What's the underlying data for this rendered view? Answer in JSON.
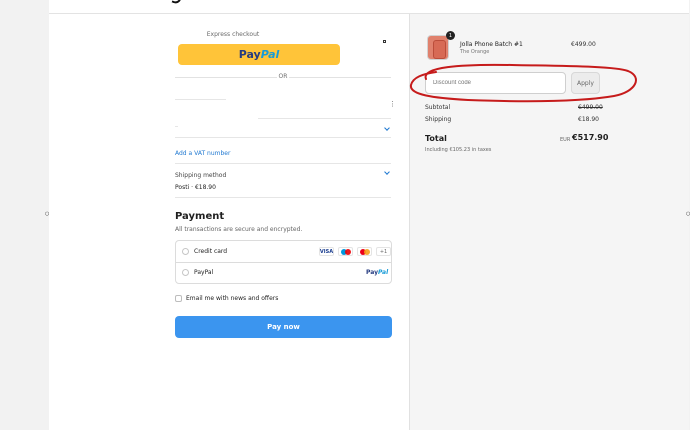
{
  "express": {
    "label": "Express checkout",
    "paypal_logo": [
      "Pay",
      "Pal"
    ],
    "or": "OR"
  },
  "form": {
    "menu_icon": "⋮",
    "vat_link": "Add a VAT number",
    "shipping": {
      "label": "Shipping method",
      "value": "Posti · €18.90"
    }
  },
  "payment": {
    "title": "Payment",
    "subtitle": "All transactions are secure and encrypted.",
    "options": [
      {
        "label": "Credit card",
        "badges": [
          "VISA",
          "",
          "",
          "+1"
        ]
      },
      {
        "label": "PayPal",
        "logo": [
          "Pay",
          "Pal"
        ]
      }
    ]
  },
  "marketing": {
    "label": "Email me with news and offers"
  },
  "actions": {
    "pay_now": "Pay now"
  },
  "summary": {
    "product": {
      "qty": "1",
      "name": "Jolla Phone Batch #1",
      "variant": "The Orange",
      "price": "€499.00"
    },
    "discount_placeholder": "Discount code",
    "apply_label": "Apply",
    "subtotal_label": "Subtotal",
    "subtotal_value": "€499.00",
    "shipping_label": "Shipping",
    "shipping_value": "€18.90",
    "total_label": "Total",
    "currency": "EUR",
    "total_value": "€517.90",
    "tax_note": "Including €105.23 in taxes"
  },
  "colors": {
    "paypal_yellow": "#ffc439",
    "primary_blue": "#3b95ef",
    "annotation_red": "#c61b1b"
  }
}
